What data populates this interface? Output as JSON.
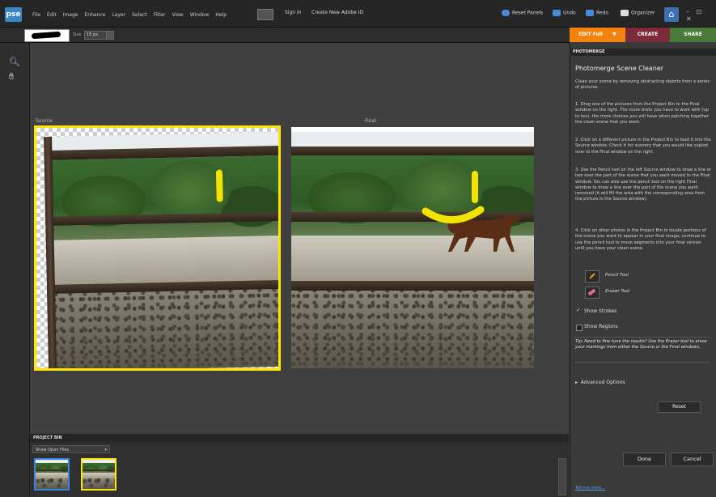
{
  "app": {
    "logo": "pse"
  },
  "menu": [
    "File",
    "Edit",
    "Image",
    "Enhance",
    "Layer",
    "Select",
    "Filter",
    "View",
    "Window",
    "Help"
  ],
  "top": {
    "sign_in": "Sign In",
    "create_id": "Create New Adobe ID",
    "reset_panels": "Reset Panels",
    "undo": "Undo",
    "redo": "Redo",
    "organizer": "Organizer",
    "window_controls": "– ⊡ ✕"
  },
  "options": {
    "size_label": "Size",
    "size_value": "15 px"
  },
  "tabs": {
    "edit": "EDIT Full",
    "create": "CREATE",
    "share": "SHARE"
  },
  "canvas": {
    "source_label": "Source",
    "final_label": "Final"
  },
  "bin": {
    "header": "PROJECT BIN",
    "select": "Show Open Files"
  },
  "panel": {
    "header": "PHOTOMERGE",
    "title": "Photomerge Scene Cleaner",
    "intro": "Clean your scene by removing obstracting objects from a series of pictures.",
    "steps": [
      "1. Drag one of the pictures from the Project Bin to the Final window on the right. The more shots you have to work with (up to ten), the more choices you will have when patching together the clean scene that you want.",
      "2. Click on a different picture in the Project Bin to load it into the Source window. Check it for scenery that you would like copied over to the Final window on the right.",
      "3. Use the Pencil tool on the left Source window to draw a line or two over the part of the scene that you want moved to the Final window. You can also use the pencil tool on the right Final window to draw a line over the part of the scene you want removed (it will fill the area with the corresponding area from the picture in the Source window).",
      "4. Click on other photos in the Project Bin to locate portions of the scene you want to appear in your final image; continue to use the pencil tool to move segments into your final version until you have your clean scene."
    ],
    "pencil_tool": "Pencil Tool",
    "eraser_tool": "Eraser Tool",
    "show_strokes": "Show Strokes",
    "show_regions": "Show Regions",
    "tip": "Tip: Need to fine tune the results? Use the Eraser tool to erase your markings from either the Source or the Final windows.",
    "advanced": "Advanced Options",
    "reset": "Reset",
    "done": "Done",
    "cancel": "Cancel",
    "learn_more": "Tell me more..."
  },
  "colors": {
    "accent_orange": "#f3820e",
    "stroke_yellow": "#ffe600",
    "create_tab": "#7c2b3a",
    "share_tab": "#4a7a38"
  }
}
